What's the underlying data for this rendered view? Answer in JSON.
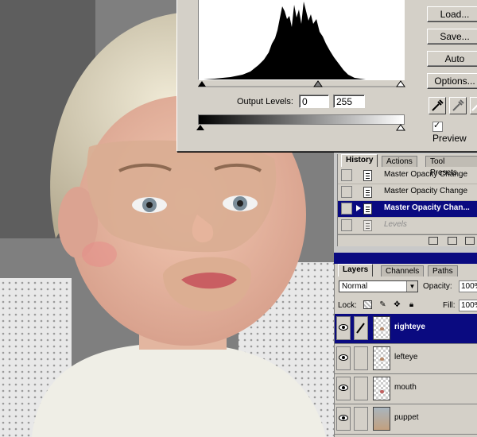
{
  "levels_dialog": {
    "buttons": [
      "Load...",
      "Save...",
      "Auto",
      "Options..."
    ],
    "output_levels_label": "Output Levels:",
    "output_min": "0",
    "output_max": "255",
    "preview_label": "Preview",
    "preview_checked": true
  },
  "history_panel": {
    "tabs": [
      "History",
      "Actions",
      "Tool Presets"
    ],
    "active_tab": "History",
    "items": [
      {
        "label": "Master Opacity Change",
        "state": "normal"
      },
      {
        "label": "Master Opacity Change",
        "state": "normal"
      },
      {
        "label": "Master Opacity Chan...",
        "state": "selected"
      },
      {
        "label": "Levels",
        "state": "disabled"
      }
    ]
  },
  "layers_panel": {
    "tabs": [
      "Layers",
      "Channels",
      "Paths"
    ],
    "active_tab": "Layers",
    "blend_mode": "Normal",
    "opacity_label": "Opacity:",
    "opacity_value": "100%",
    "lock_label": "Lock:",
    "fill_label": "Fill:",
    "fill_value": "100%",
    "layers": [
      {
        "name": "righteye",
        "selected": true,
        "visible": true,
        "thumbnail": "transparent"
      },
      {
        "name": "lefteye",
        "selected": false,
        "visible": true,
        "thumbnail": "transparent"
      },
      {
        "name": "mouth",
        "selected": false,
        "visible": true,
        "thumbnail": "transparent"
      },
      {
        "name": "puppet",
        "selected": false,
        "visible": true,
        "thumbnail": "photo"
      }
    ]
  },
  "icons": {
    "visibility": "eye-icon",
    "brush": "brush-icon",
    "history_snapshot": "history-state-icon",
    "eyedroppers": [
      "eyedropper-black-icon",
      "eyedropper-gray-icon",
      "eyedropper-white-icon"
    ]
  },
  "colors": {
    "selection_blue": "#0a0a80",
    "panel_gray": "#d4d0c8"
  }
}
